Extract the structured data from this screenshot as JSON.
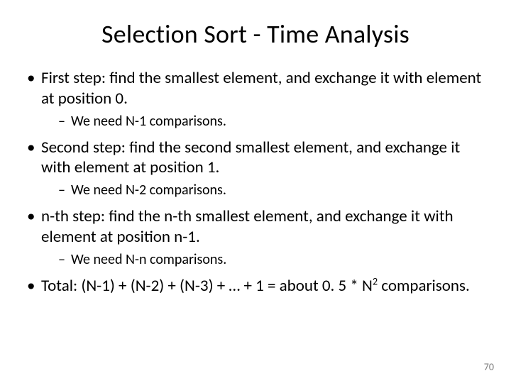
{
  "title": "Selection Sort - Time Analysis",
  "b1": "First step: find the smallest element, and exchange it with element at position 0.",
  "s1": "We need N-1 comparisons.",
  "b2": "Second step: find the second smallest element, and exchange it with element at position 1.",
  "s2": "We need N-2 comparisons.",
  "b3": "n-th step: find the n-th smallest element, and exchange it with element at position n-1.",
  "s3": "We need N-n comparisons.",
  "b4a": "Total: (N-1) + (N-2) + (N-3) + … + 1 = about 0. 5 * N",
  "b4exp": "2",
  "b4b": " comparisons.",
  "page": "70"
}
